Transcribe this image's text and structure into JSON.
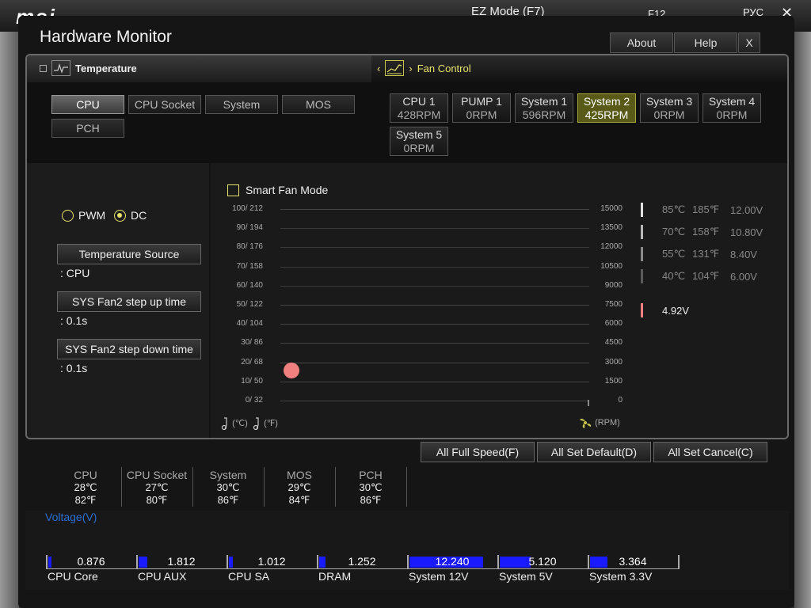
{
  "background": {
    "brand": "msi",
    "mode_label": "EZ Mode (F7)",
    "f12_label": "F12",
    "lang_label": "РУС",
    "close_glyph": "✕"
  },
  "window": {
    "title": "Hardware Monitor",
    "about_label": "About",
    "help_label": "Help",
    "close_label": "X"
  },
  "temperature_tab": {
    "label": "Temperature",
    "sources": [
      {
        "label": "CPU",
        "active": true
      },
      {
        "label": "CPU Socket",
        "active": false
      },
      {
        "label": "System",
        "active": false
      },
      {
        "label": "MOS",
        "active": false
      },
      {
        "label": "PCH",
        "active": false
      }
    ]
  },
  "fan_tab": {
    "label": "Fan Control",
    "fans": [
      {
        "name": "CPU 1",
        "rpm": "428RPM",
        "active": false
      },
      {
        "name": "PUMP 1",
        "rpm": "0RPM",
        "active": false
      },
      {
        "name": "System 1",
        "rpm": "596RPM",
        "active": false
      },
      {
        "name": "System 2",
        "rpm": "425RPM",
        "active": true
      },
      {
        "name": "System 3",
        "rpm": "0RPM",
        "active": false
      },
      {
        "name": "System 4",
        "rpm": "0RPM",
        "active": false
      },
      {
        "name": "System 5",
        "rpm": "0RPM",
        "active": false
      }
    ]
  },
  "fan_settings": {
    "pwm_label": "PWM",
    "dc_label": "DC",
    "selected_mode": "DC",
    "temp_source_label": "Temperature Source",
    "temp_source_value": ": CPU",
    "step_up_label": "SYS Fan2 step up time",
    "step_up_value": ": 0.1s",
    "step_down_label": "SYS Fan2 step down time",
    "step_down_value": ": 0.1s"
  },
  "chart": {
    "smart_fan_label": "Smart Fan Mode",
    "smart_fan_checked": false,
    "left_ticks": [
      "100/ 212",
      "90/ 194",
      "80/ 176",
      "70/ 158",
      "60/ 140",
      "50/ 122",
      "40/ 104",
      "30/  86",
      "20/  68",
      "10/  50",
      "0/  32"
    ],
    "right_ticks": [
      "15000",
      "13500",
      "12000",
      "10500",
      "9000",
      "7500",
      "6000",
      "4500",
      "3000",
      "1500",
      "0"
    ],
    "celsius_unit": "(℃)",
    "fahrenheit_unit": "(℉)",
    "rpm_unit": "(RPM)",
    "legend": [
      {
        "c": "85℃",
        "f": "185℉",
        "v": "12.00V",
        "color": "#e0e0e0"
      },
      {
        "c": "70℃",
        "f": "158℉",
        "v": "10.80V",
        "color": "#b8b8b8"
      },
      {
        "c": "55℃",
        "f": "131℉",
        "v": "8.40V",
        "color": "#8a8a8a"
      },
      {
        "c": "40℃",
        "f": "104℉",
        "v": "6.00V",
        "color": "#5a5a5a"
      }
    ],
    "current_voltage": "4.92V",
    "current_color": "#f08080"
  },
  "actions": {
    "full_speed": "All Full Speed(F)",
    "set_default": "All Set Default(D)",
    "set_cancel": "All Set Cancel(C)"
  },
  "temps": [
    {
      "name": "CPU",
      "c": "28℃",
      "f": "82℉"
    },
    {
      "name": "CPU Socket",
      "c": "27℃",
      "f": "80℉"
    },
    {
      "name": "System",
      "c": "30℃",
      "f": "86℉"
    },
    {
      "name": "MOS",
      "c": "29℃",
      "f": "84℉"
    },
    {
      "name": "PCH",
      "c": "30℃",
      "f": "86℉"
    }
  ],
  "voltage": {
    "title": "Voltage(V)",
    "items": [
      {
        "name": "CPU Core",
        "value": "0.876",
        "fill": 0.04
      },
      {
        "name": "CPU AUX",
        "value": "1.812",
        "fill": 0.1
      },
      {
        "name": "CPU SA",
        "value": "1.012",
        "fill": 0.05
      },
      {
        "name": "DRAM",
        "value": "1.252",
        "fill": 0.07
      },
      {
        "name": "System 12V",
        "value": "12.240",
        "fill": 0.86
      },
      {
        "name": "System 5V",
        "value": "5.120",
        "fill": 0.36
      },
      {
        "name": "System 3.3V",
        "value": "3.364",
        "fill": 0.2
      }
    ]
  }
}
